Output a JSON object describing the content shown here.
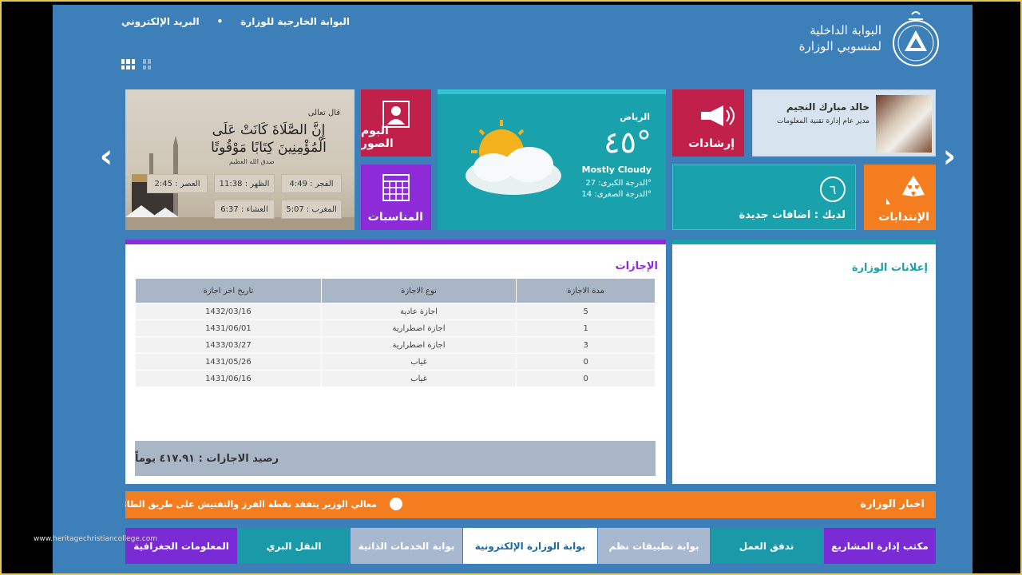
{
  "topnav": {
    "external_portal": "البوابة الخارجية للوزارة",
    "separator": "•",
    "email": "البريد الإلكتروني"
  },
  "brand": {
    "line1": "البوابة الداخلية",
    "line2": "لمنسوبي الوزارة"
  },
  "profile": {
    "name": "خالد مبارك النجيم",
    "title": "مدير عام إدارة تقنية المعلومات"
  },
  "tiles": {
    "announcements_label": "إرشادات",
    "albums_label": "البوم الصور",
    "occasions_label": "المناسبات",
    "nominations_label": "الإنتدابات",
    "new_additions_count": "٦",
    "new_additions_label": "لديك : اضافات جديدة"
  },
  "weather": {
    "city": "الرياض",
    "temp": "٤٥°",
    "condition": "Mostly Cloudy",
    "max": "الدرجة الكبرى: 27°",
    "min": "الدرجة الصغرى: 14°"
  },
  "prayer": {
    "quote_intro": "قال تعالى",
    "verse": "إِنَّ الصَّلَاةَ كَانَتْ عَلَى الْمُؤْمِنِينَ كِتَابًا مَوْقُوتًا",
    "attribution": "صدق الله العظيم",
    "times": [
      {
        "label": "الفجر : 4:49"
      },
      {
        "label": "الظهر : 11:38"
      },
      {
        "label": "العصر : 2:45"
      },
      {
        "label": "المغرب : 5:07"
      },
      {
        "label": "العشاء : 6:37"
      }
    ]
  },
  "leaves": {
    "title": "الإجازات",
    "columns": [
      "مدة الاجازة",
      "نوع الاجازة",
      "تاريخ اخر اجازة"
    ],
    "rows": [
      [
        "5",
        "اجازة عادية",
        "1432/03/16"
      ],
      [
        "1",
        "اجازة اضطرارية",
        "1431/06/01"
      ],
      [
        "3",
        "اجازة اضطرارية",
        "1433/03/27"
      ],
      [
        "0",
        "غياب",
        "1431/05/26"
      ],
      [
        "0",
        "غياب",
        "1431/06/16"
      ]
    ],
    "balance": "رصيد الاجازات : ٤١٧.٩١ يوماً"
  },
  "ministry_ads": {
    "title": "إعلانات الوزارة"
  },
  "news": {
    "title": "اخبار الوزارة",
    "headline": "معالي الوزير يتفقد نقطة الفرز والتفتيش على طريق الطائف"
  },
  "bottom_tabs": [
    {
      "label": "مكتب إدارة المشاريع",
      "color": "#7b2bd6"
    },
    {
      "label": "تدفق العمل",
      "color": "#1a9aa8"
    },
    {
      "label": "بوابة تطبيقات نظم",
      "color": "#a8b8cf"
    },
    {
      "label": "بوابة الوزارة الإلكترونية",
      "color": "#ffffff"
    },
    {
      "label": "بوابة الخدمات الذاتية",
      "color": "#a8b8cf"
    },
    {
      "label": "النقل البري",
      "color": "#1a9aa8"
    },
    {
      "label": "المعلومات الجغرافية",
      "color": "#7b2bd6"
    }
  ],
  "watermark": "www.heritagechristiancollege.com"
}
